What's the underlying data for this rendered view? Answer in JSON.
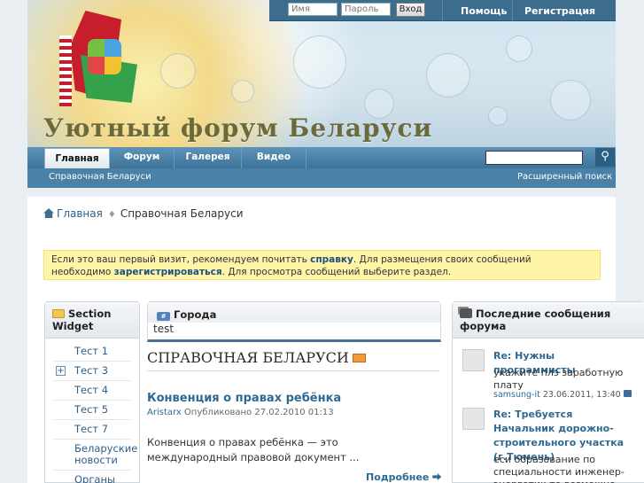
{
  "header": {
    "forum_title": "Уютный форум Беларуси",
    "login": {
      "username_placeholder": "Имя",
      "password_placeholder": "Пароль",
      "login_button": "Вход"
    },
    "top_links": [
      "Помощь",
      "Регистрация"
    ]
  },
  "nav": {
    "tabs": [
      "Главная",
      "Форум",
      "Галерея",
      "Видео"
    ],
    "active_tab": "Главная",
    "sub_left": "Справочная Беларуси",
    "sub_right": "Расширенный поиск",
    "search_icon": "search-icon"
  },
  "breadcrumb": {
    "home": "Главная",
    "current": "Справочная Беларуси"
  },
  "notice": {
    "part1": "Если это ваш первый визит, рекомендуем почитать ",
    "link1": "справку",
    "part2": ". Для размещения своих сообщений необходимо ",
    "link2": "зарегистрироваться",
    "part3": ". Для просмотра сообщений выберите раздел."
  },
  "left_widget": {
    "title": "Section Widget",
    "items": [
      "Тест 1",
      "Тест 3",
      "Тест 4",
      "Тест 5",
      "Тест 7",
      "Беларуские новости",
      "Органы"
    ]
  },
  "middle": {
    "box_title": "Города",
    "box_text": "test",
    "section_title": "СПРАВОЧНАЯ БЕЛАРУСИ",
    "article": {
      "title": "Конвенция о правах ребёнка",
      "author": "Aristarx",
      "meta": " Опубликовано 27.02.2010 01:13",
      "body": "Конвенция о правах ребёнка — это международный правовой документ ...",
      "more": "Подробнее"
    }
  },
  "right_widget": {
    "title": "Последние сообщения форума",
    "posts": [
      {
        "title": "Re: Нужны программисты",
        "text": "укажите плз заработную плату",
        "author": "samsung-it",
        "date": " 23.06.2011, 13:40"
      },
      {
        "title": "Re: Требуется Начальник дорожно-строительного участка (г.Тюмень)",
        "text": "еси образование по специальности инженер-энергетик то возможно"
      }
    ]
  },
  "colors": {
    "accent": "#3e739a",
    "link": "#2d6a93",
    "notice_bg": "#fef5a8"
  }
}
